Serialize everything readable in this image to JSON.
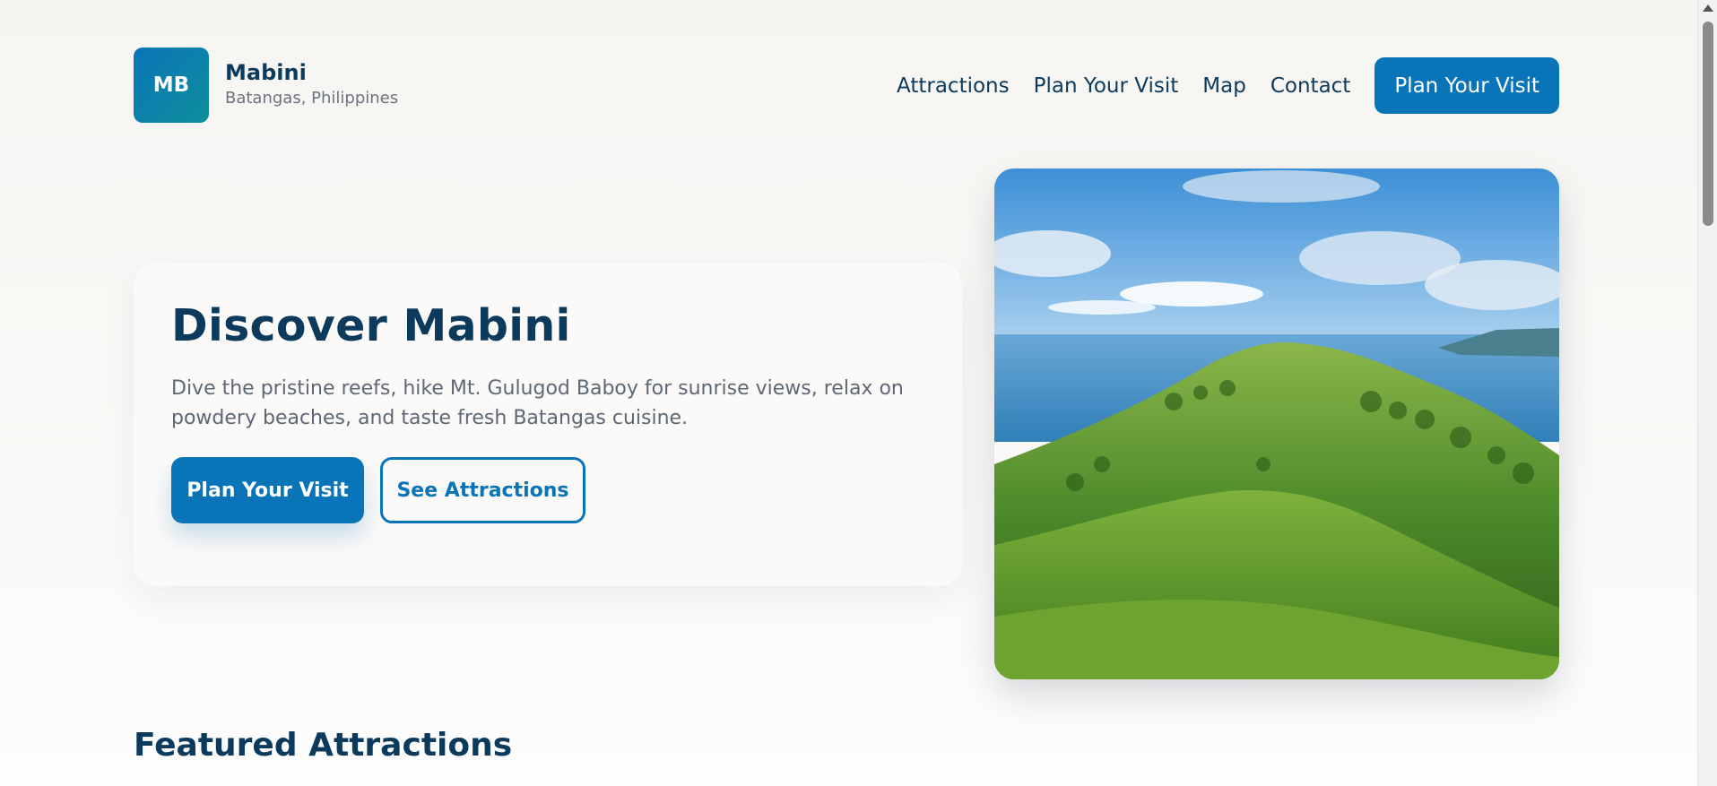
{
  "brand": {
    "badge": "MB",
    "name": "Mabini",
    "location": "Batangas, Philippines"
  },
  "nav": {
    "links": [
      "Attractions",
      "Plan Your Visit",
      "Map",
      "Contact"
    ],
    "cta": "Plan Your Visit"
  },
  "hero": {
    "title": "Discover Mabini",
    "description": "Dive the pristine reefs, hike Mt. Gulugod Baboy for sunrise views, relax on powdery beaches, and taste fresh Batangas cuisine.",
    "primary_button": "Plan Your Visit",
    "secondary_button": "See Attractions",
    "image": "green hill overlooking sea"
  },
  "featured": {
    "title": "Featured Attractions"
  },
  "colors": {
    "primary": "#0a74b8",
    "heading": "#0b3a5c",
    "muted": "#5e6875",
    "teal": "#0e8f9c"
  }
}
